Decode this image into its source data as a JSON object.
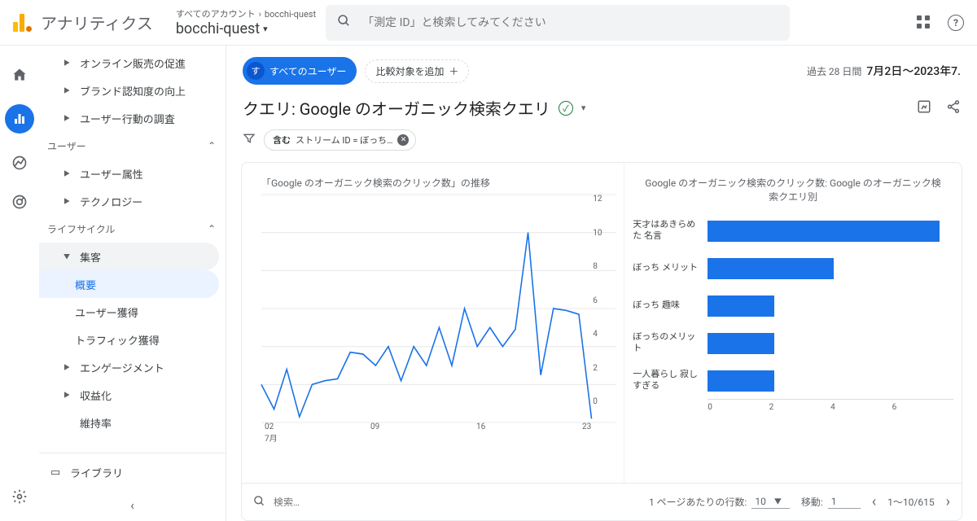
{
  "header": {
    "product": "アナリティクス",
    "breadcrumb_top_a": "すべてのアカウント",
    "breadcrumb_top_b": "bocchi-quest",
    "breadcrumb_main": "bocchi-quest",
    "search_placeholder": "「測定 ID」と検索してみてください"
  },
  "date": {
    "label": "過去 28 日間",
    "range": "7月2日～2023年7."
  },
  "chips": {
    "all_users_badge": "す",
    "all_users": "すべてのユーザー",
    "add_compare": "比較対象を追加",
    "plus": "＋"
  },
  "page": {
    "title": "クエリ: Google のオーガニック検索クエリ"
  },
  "filter": {
    "label": "含む",
    "value": "ストリーム ID = ぼっち…"
  },
  "sidebar": {
    "items": [
      {
        "label": "オンライン販売の促進",
        "type": "sub"
      },
      {
        "label": "ブランド認知度の向上",
        "type": "sub"
      },
      {
        "label": "ユーザー行動の調査",
        "type": "sub"
      }
    ],
    "sec_user": "ユーザー",
    "user_items": [
      "ユーザー属性",
      "テクノロジー"
    ],
    "sec_life": "ライフサイクル",
    "life_items": [
      {
        "label": "集客",
        "open": true,
        "hl": true
      },
      {
        "label": "概要",
        "sel": true,
        "depth": 2
      },
      {
        "label": "ユーザー獲得",
        "depth": 2
      },
      {
        "label": "トラフィック獲得",
        "depth": 2
      },
      {
        "label": "エンゲージメント"
      },
      {
        "label": "収益化"
      },
      {
        "label": "維持率",
        "leaf": true
      }
    ],
    "library": "ライブラリ"
  },
  "chart_data": [
    {
      "type": "line",
      "title": "「Google のオーガニック検索のクリック数」の推移",
      "ylim": [
        0,
        12
      ],
      "yticks": [
        0,
        2,
        4,
        6,
        8,
        10,
        12
      ],
      "x": [
        "02",
        "03",
        "04",
        "05",
        "06",
        "07",
        "08",
        "09",
        "10",
        "11",
        "12",
        "13",
        "14",
        "15",
        "16",
        "17",
        "18",
        "19",
        "20",
        "21",
        "22",
        "23",
        "24",
        "25",
        "26",
        "27",
        "28"
      ],
      "x_month": "7月",
      "xticks": [
        "02",
        "09",
        "16",
        "23"
      ],
      "values": [
        2,
        0.7,
        2.8,
        0.3,
        2,
        2.2,
        2.3,
        3.7,
        3.6,
        3,
        4,
        2.2,
        4,
        3,
        5,
        3,
        6,
        4,
        5,
        4,
        4.9,
        10,
        2.5,
        6,
        5.9,
        5.7,
        0.2
      ]
    },
    {
      "type": "bar",
      "title": "Google のオーガニック検索のクリック数: Google のオーガニック検索クエリ別",
      "xlim": [
        0,
        7
      ],
      "xticks": [
        0,
        2,
        4,
        6
      ],
      "categories": [
        "天才はあきらめた 名言",
        "ぼっち メリット",
        "ぼっち 趣味",
        "ぼっちのメリット",
        "一人暮らし 寂しすぎる"
      ],
      "values": [
        6.6,
        3.6,
        1.9,
        1.9,
        1.9
      ]
    }
  ],
  "pager": {
    "search_placeholder": "検索…",
    "rows_label": "1 ページあたりの行数:",
    "rows_value": "10",
    "goto_label": "移動:",
    "goto_value": "1",
    "range": "1～10/615"
  }
}
